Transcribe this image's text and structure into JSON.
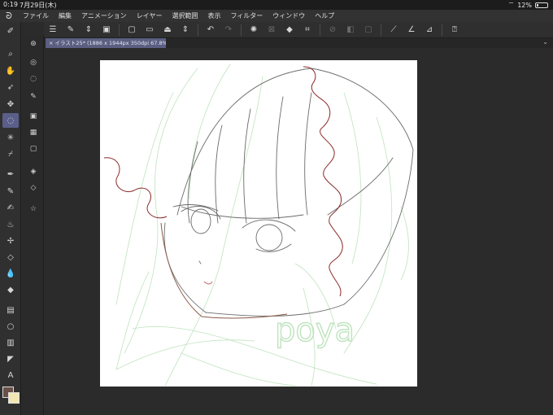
{
  "status": {
    "time": "0:19",
    "date": "7月29日(木)",
    "battery": "12%",
    "battery_level": 0.12
  },
  "menu": {
    "items": [
      "ファイル",
      "編集",
      "アニメーション",
      "レイヤー",
      "選択範囲",
      "表示",
      "フィルター",
      "ウィンドウ",
      "ヘルプ"
    ]
  },
  "tab": {
    "title": "イラスト25* (1886 x 1944px 350dpi 67.8%)"
  },
  "canvas": {
    "signature": "poya"
  },
  "colors": {
    "main": "#6a5048",
    "sub": "#f2e7b2",
    "tab_active": "#5b5f82"
  }
}
